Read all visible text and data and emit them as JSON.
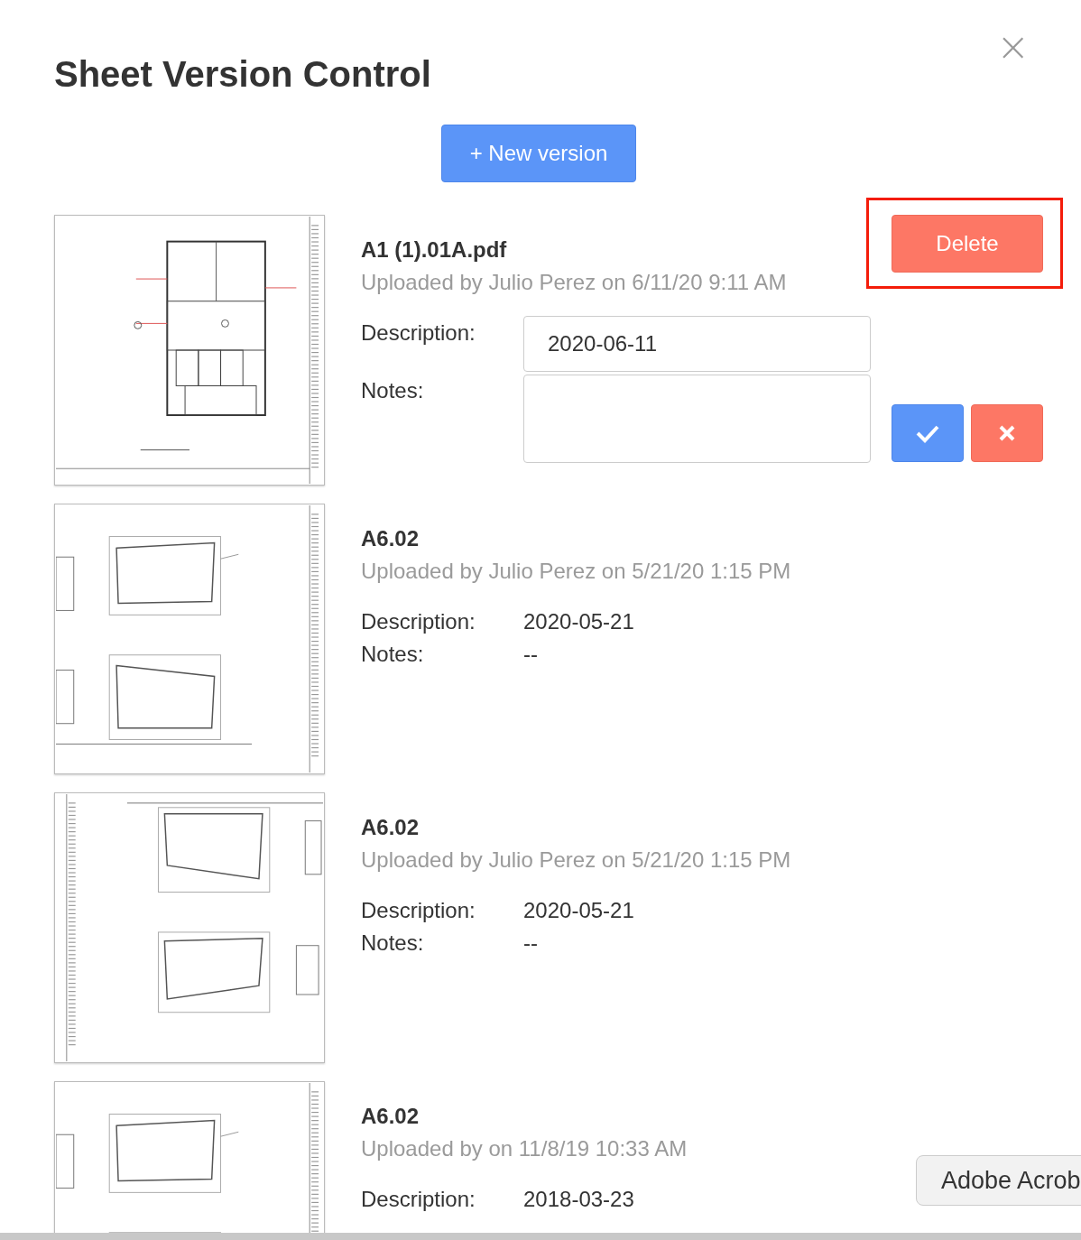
{
  "dialog": {
    "title": "Sheet Version Control",
    "close": "×"
  },
  "new_version_button": {
    "label": "+ New version"
  },
  "versions": [
    {
      "thumbnail": {
        "kind": "floor_plan"
      },
      "name": "A1 (1).01A.pdf",
      "uploaded": "Uploaded by Julio Perez on 6/11/20 9:11 AM",
      "description_label": "Description:",
      "description": "2020-06-11",
      "notes_label": "Notes:",
      "editing": true,
      "delete_button": {
        "label": "Delete",
        "highlighted": true
      }
    },
    {
      "thumbnail": {
        "kind": "elevation"
      },
      "name": "A6.02",
      "uploaded": "Uploaded by Julio Perez on 5/21/20 1:15 PM",
      "description_label": "Description:",
      "description": "2020-05-21",
      "notes_label": "Notes:",
      "notes": "--",
      "editing": false
    },
    {
      "thumbnail": {
        "kind": "elevation_rotated"
      },
      "name": "A6.02",
      "uploaded": "Uploaded by Julio Perez on 5/21/20 1:15 PM",
      "description_label": "Description:",
      "description": "2020-05-21",
      "notes_label": "Notes:",
      "notes": "--",
      "editing": false
    },
    {
      "thumbnail": {
        "kind": "elevation"
      },
      "name": "A6.02",
      "uploaded": "Uploaded by on 11/8/19 10:33 AM",
      "description_label": "Description:",
      "description": "2018-03-23",
      "editing": false
    }
  ],
  "tooltip": {
    "text": "Adobe Acrob"
  }
}
